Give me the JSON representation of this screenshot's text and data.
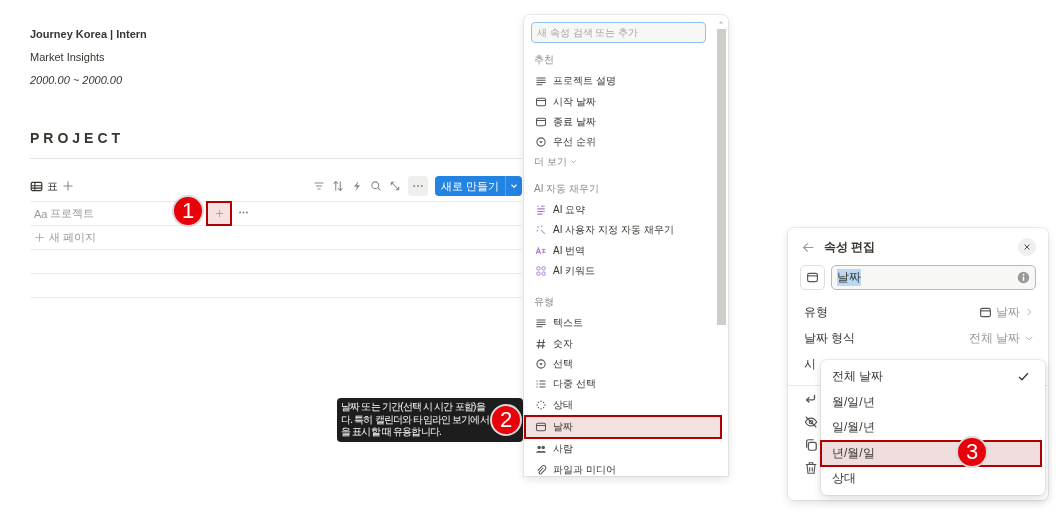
{
  "page": {
    "title": "Journey Korea | Intern",
    "subtitle": "Market Insights",
    "dates": "2000.00 ~ 2000.00"
  },
  "database": {
    "heading": "PROJECT",
    "view_tab": "표",
    "new_button": "새로 만들기",
    "column_icon": "Aa",
    "column": "프로젝트",
    "add_column": {
      "highlighted": true
    },
    "new_page": "새 페이지"
  },
  "tooltip": {
    "lines": [
      "날짜 또는 기간(선택 시 시간 포함)을",
      "다. 특히 캘린더와 타임라인 보기에서",
      "을 표시할 때 유용합니다."
    ]
  },
  "property_menu": {
    "placeholder": "새 속성 검색 또는 추가",
    "sections": [
      {
        "title": "추천",
        "items": [
          {
            "label": "프로젝트 설명",
            "kind": "lines"
          },
          {
            "label": "시작 날짜",
            "kind": "calendar"
          },
          {
            "label": "종료 날짜",
            "kind": "calendar"
          },
          {
            "label": "우선 순위",
            "kind": "select"
          }
        ],
        "more": "더 보기"
      },
      {
        "title": "AI 자동 채우기",
        "items": [
          {
            "label": "AI 요약",
            "kind": "ai-summary"
          },
          {
            "label": "AI 사용자 지정 자동 채우기",
            "kind": "ai-wand"
          },
          {
            "label": "AI 번역",
            "kind": "ai-translate"
          },
          {
            "label": "AI 키워드",
            "kind": "ai-keywords"
          }
        ]
      },
      {
        "title": "유형",
        "items": [
          {
            "label": "텍스트",
            "kind": "lines",
            "selected": false
          },
          {
            "label": "숫자",
            "kind": "hash",
            "selected": false
          },
          {
            "label": "선택",
            "kind": "select",
            "selected": false
          },
          {
            "label": "다중 선택",
            "kind": "list",
            "selected": false
          },
          {
            "label": "상태",
            "kind": "status",
            "selected": false
          },
          {
            "label": "날짜",
            "kind": "calendar",
            "selected": true
          },
          {
            "label": "사람",
            "kind": "people",
            "selected": false
          },
          {
            "label": "파일과 미디어",
            "kind": "clip",
            "selected": false
          }
        ]
      }
    ]
  },
  "editor": {
    "title": "속성 편집",
    "name": "날짜",
    "name_selected": true,
    "rows": [
      {
        "label": "유형",
        "value": "날짜",
        "kind": "nav"
      },
      {
        "label": "날짜 형식",
        "value": "전체 날짜",
        "kind": "dropdown"
      },
      {
        "label": "시",
        "kind": "plain"
      }
    ],
    "formats": [
      {
        "label": "전체 날짜",
        "checked": true,
        "highlighted": false
      },
      {
        "label": "월/일/년",
        "checked": false,
        "highlighted": false
      },
      {
        "label": "일/월/년",
        "checked": false,
        "highlighted": false
      },
      {
        "label": "년/월/일",
        "checked": false,
        "highlighted": true
      },
      {
        "label": "상대",
        "checked": false,
        "highlighted": false
      }
    ]
  },
  "callouts": [
    "1",
    "2",
    "3"
  ]
}
